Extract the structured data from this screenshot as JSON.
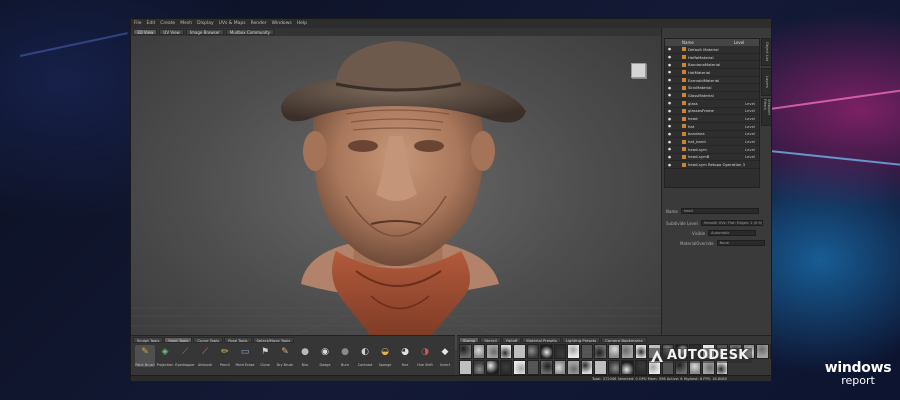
{
  "menubar": {
    "items": [
      "File",
      "Edit",
      "Create",
      "Mesh",
      "Display",
      "UVs & Maps",
      "Render",
      "Windows",
      "Help"
    ]
  },
  "tabs": {
    "items": [
      "3D View",
      "UV View",
      "Image Browser",
      "Mudbox Community"
    ],
    "active_index": 0
  },
  "outliner": {
    "header": {
      "col1": "Name",
      "col2": "Level"
    },
    "rows": [
      {
        "name": "Default Material",
        "level": ""
      },
      {
        "name": "HeffaMaterial",
        "level": ""
      },
      {
        "name": "BandanaMaterial",
        "level": ""
      },
      {
        "name": "HatMaterial",
        "level": ""
      },
      {
        "name": "EarmoldMaterial",
        "level": ""
      },
      {
        "name": "SkinMaterial",
        "level": ""
      },
      {
        "name": "GlassMaterial",
        "level": ""
      },
      {
        "name": "glass",
        "level": "Level"
      },
      {
        "name": "glassesFrame",
        "level": "Level"
      },
      {
        "name": "head",
        "level": "Level"
      },
      {
        "name": "hat",
        "level": "Level"
      },
      {
        "name": "bandana",
        "level": "Level"
      },
      {
        "name": "hat_band",
        "level": "Level"
      },
      {
        "name": "head-sym",
        "level": "Level"
      },
      {
        "name": "head-symB",
        "level": "Level"
      },
      {
        "name": "head-sym Retopo Operation 3",
        "level": ""
      }
    ]
  },
  "side_tabs": [
    "Object List",
    "Layers",
    "Viewport Filters"
  ],
  "properties": {
    "name_label": "Name",
    "name_value": "head",
    "row2_label": "Subdivide Level",
    "row2_value": "Smooth UVs: Flat: Edges: 1 (0:9)",
    "row3_label": "Visible",
    "row3_value": "Automatic",
    "row4_label": "MaterialOverride",
    "row4_value": "None"
  },
  "shelf": {
    "tabs": [
      "Sculpt Tools",
      "Paint Tools",
      "Curve Tools",
      "Pose Tools",
      "Select/Move Tools"
    ],
    "active_tab": 1,
    "tools": [
      {
        "label": "Paint Brush",
        "icon": "paint-brush-icon",
        "glyph": "✎",
        "color": "#d9a24a"
      },
      {
        "label": "Projection",
        "icon": "projection-icon",
        "glyph": "◈",
        "color": "#6fc27a"
      },
      {
        "label": "Eyedropper",
        "icon": "eyedropper-icon",
        "glyph": "⟋",
        "color": "#4a8fd8"
      },
      {
        "label": "Airbrush",
        "icon": "airbrush-icon",
        "glyph": "⟋",
        "color": "#e0675a"
      },
      {
        "label": "Pencil",
        "icon": "pencil-icon",
        "glyph": "✏",
        "color": "#e2c14a"
      },
      {
        "label": "Paint Erase",
        "icon": "paint-erase-icon",
        "glyph": "▭",
        "color": "#8aa6d8"
      },
      {
        "label": "Clone",
        "icon": "clone-icon",
        "glyph": "⚑",
        "color": "#cfcfcf"
      },
      {
        "label": "Dry Brush",
        "icon": "dry-brush-icon",
        "glyph": "✎",
        "color": "#d6b27a"
      },
      {
        "label": "Blur",
        "icon": "blur-icon",
        "glyph": "●",
        "color": "#b9b9b9"
      },
      {
        "label": "Dodge",
        "icon": "dodge-icon",
        "glyph": "◉",
        "color": "#dddddd"
      },
      {
        "label": "Burn",
        "icon": "burn-icon",
        "glyph": "●",
        "color": "#8a8a8a"
      },
      {
        "label": "Contrast",
        "icon": "contrast-icon",
        "glyph": "◐",
        "color": "#d0d0d0"
      },
      {
        "label": "Sponge",
        "icon": "sponge-icon",
        "glyph": "◒",
        "color": "#e1b24e"
      },
      {
        "label": "Hue",
        "icon": "hue-icon",
        "glyph": "◕",
        "color": "#e0e0e0"
      },
      {
        "label": "Hue Shift",
        "icon": "hue-shift-icon",
        "glyph": "◑",
        "color": "#c85a5a"
      },
      {
        "label": "Invert",
        "icon": "invert-icon",
        "glyph": "◆",
        "color": "#e6e6e6"
      }
    ]
  },
  "stamps": {
    "tabs": [
      "Stamp",
      "Stencil",
      "Falloff",
      "Material Presets",
      "Lighting Presets",
      "Camera Bookmarks"
    ],
    "active_tab": 0
  },
  "branding": {
    "logo_text": "AUTODESK"
  },
  "statusbar": {
    "text": "Total: 372046  Selected: 0  GPU Mem: 596  Active: 6  Highest: 6  FPS: 18.8085"
  },
  "watermark": {
    "line1": "windows",
    "line2": "report"
  }
}
